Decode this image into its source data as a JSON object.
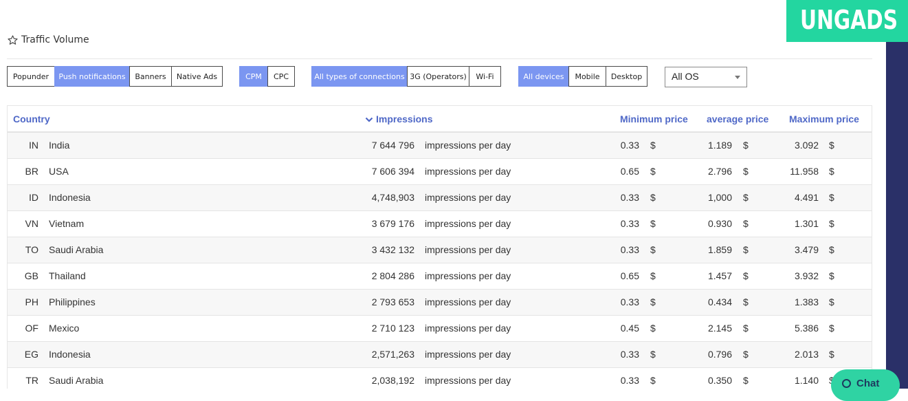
{
  "brand": {
    "logo_text": "UNGADS",
    "accent": "#23d6a0",
    "sidebar_color": "#2a3068"
  },
  "header": {
    "title": "Traffic Volume",
    "icon": "star-outline-icon"
  },
  "filters": {
    "ad_formats": [
      {
        "label": "Popunder",
        "active": false
      },
      {
        "label": "Push notifications",
        "active": true
      },
      {
        "label": "Banners",
        "active": false
      },
      {
        "label": "Native Ads",
        "active": false
      }
    ],
    "pricing": [
      {
        "label": "CPM",
        "active": true
      },
      {
        "label": "CPC",
        "active": false
      }
    ],
    "connections": [
      {
        "label": "All types of connections",
        "active": true
      },
      {
        "label": "3G (Operators)",
        "active": false
      },
      {
        "label": "Wi-Fi",
        "active": false
      }
    ],
    "devices": [
      {
        "label": "All devices",
        "active": true
      },
      {
        "label": "Mobile",
        "active": false
      },
      {
        "label": "Desktop",
        "active": false
      }
    ],
    "os_select": {
      "value": "All OS"
    },
    "active_color": "#7b96f1"
  },
  "table": {
    "columns": {
      "country": "Country",
      "impressions": "Impressions",
      "min_price": "Minimum price",
      "avg_price": "average price",
      "max_price": "Maximum price"
    },
    "sort_icon": "chevron-down-icon",
    "header_color": "#4f68c7",
    "rows": [
      {
        "code": "IN",
        "country": "India",
        "impressions": "7 644 796",
        "unit": "impressions per day",
        "min": "0.33",
        "min_cur": "$",
        "avg": "1.189",
        "avg_cur": "$",
        "max": "3.092",
        "max_cur": "$"
      },
      {
        "code": "BR",
        "country": "USA",
        "impressions": "7 606 394",
        "unit": "impressions per day",
        "min": "0.65",
        "min_cur": "$",
        "avg": "2.796",
        "avg_cur": "$",
        "max": "11.958",
        "max_cur": "$"
      },
      {
        "code": "ID",
        "country": "Indonesia",
        "impressions": "4,748,903",
        "unit": "impressions per day",
        "min": "0.33",
        "min_cur": "$",
        "avg": "1,000",
        "avg_cur": "$",
        "max": "4.491",
        "max_cur": "$"
      },
      {
        "code": "VN",
        "country": "Vietnam",
        "impressions": "3 679 176",
        "unit": "impressions per day",
        "min": "0.33",
        "min_cur": "$",
        "avg": "0.930",
        "avg_cur": "$",
        "max": "1.301",
        "max_cur": "$"
      },
      {
        "code": "TO",
        "country": "Saudi Arabia",
        "impressions": "3 432 132",
        "unit": "impressions per day",
        "min": "0.33",
        "min_cur": "$",
        "avg": "1.859",
        "avg_cur": "$",
        "max": "3.479",
        "max_cur": "$"
      },
      {
        "code": "GB",
        "country": "Thailand",
        "impressions": "2 804 286",
        "unit": "impressions per day",
        "min": "0.65",
        "min_cur": "$",
        "avg": "1.457",
        "avg_cur": "$",
        "max": "3.932",
        "max_cur": "$"
      },
      {
        "code": "PH",
        "country": "Philippines",
        "impressions": "2 793 653",
        "unit": "impressions per day",
        "min": "0.33",
        "min_cur": "$",
        "avg": "0.434",
        "avg_cur": "$",
        "max": "1.383",
        "max_cur": "$"
      },
      {
        "code": "OF",
        "country": "Mexico",
        "impressions": "2 710 123",
        "unit": "impressions per day",
        "min": "0.45",
        "min_cur": "$",
        "avg": "2.145",
        "avg_cur": "$",
        "max": "5.386",
        "max_cur": "$"
      },
      {
        "code": "EG",
        "country": "Indonesia",
        "impressions": "2,571,263",
        "unit": "impressions per day",
        "min": "0.33",
        "min_cur": "$",
        "avg": "0.796",
        "avg_cur": "$",
        "max": "2.013",
        "max_cur": "$"
      },
      {
        "code": "TR",
        "country": "Saudi Arabia",
        "impressions": "2,038,192",
        "unit": "impressions per day",
        "min": "0.33",
        "min_cur": "$",
        "avg": "0.350",
        "avg_cur": "$",
        "max": "1.140",
        "max_cur": "$"
      }
    ]
  },
  "chat": {
    "label": "Chat",
    "icon": "chat-bubble-icon",
    "color": "#2fd3a3"
  }
}
